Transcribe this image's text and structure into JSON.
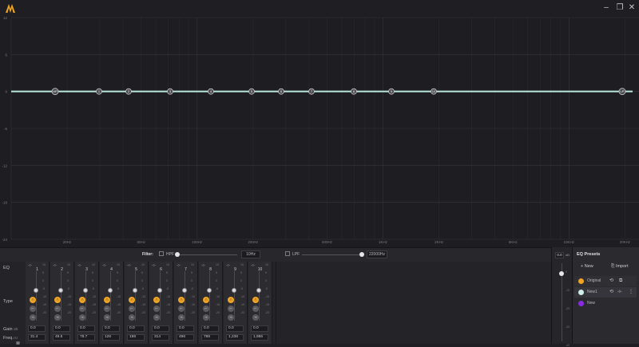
{
  "window": {
    "logo": "app-logo-icon",
    "buttons": [
      "minimize-icon",
      "maximize-icon",
      "close-icon"
    ]
  },
  "graph": {
    "y_ticks": [
      "12",
      "6",
      "0",
      "-6",
      "-12",
      "-18",
      "-24"
    ],
    "x_ticks": [
      "20Hz",
      "50Hz",
      "100Hz",
      "200Hz",
      "500Hz",
      "1KHz",
      "2KHz",
      "5KHz",
      "10KHz",
      "20KHz"
    ],
    "curve_color": "#b9e8df",
    "node_labels": [
      "HP",
      "1",
      "2",
      "3",
      "4",
      "5",
      "6",
      "7",
      "8",
      "9",
      "10",
      "LP"
    ]
  },
  "filter": {
    "label": "Filter:",
    "hpf_label": "HPF",
    "hpf_value": "10Hz",
    "lpf_label": "LPF",
    "lpf_value": "22000Hz"
  },
  "rows": {
    "eq": "EQ",
    "type": "Type",
    "gain": "Gain",
    "gain_unit": "dB",
    "freq": "Freq.",
    "freq_unit": "Hz",
    "q_label": "Q"
  },
  "band_scale": [
    "10",
    "5",
    "0",
    "-5",
    "-10",
    "-15",
    "-20"
  ],
  "bands": [
    {
      "num": "1",
      "gain": "0.0",
      "freq": "31.4"
    },
    {
      "num": "2",
      "gain": "0.0",
      "freq": "49.5"
    },
    {
      "num": "3",
      "gain": "0.0",
      "freq": "78.7"
    },
    {
      "num": "4",
      "gain": "0.0",
      "freq": "126"
    },
    {
      "num": "5",
      "gain": "0.0",
      "freq": "198"
    },
    {
      "num": "6",
      "gain": "0.0",
      "freq": "314"
    },
    {
      "num": "7",
      "gain": "0.0",
      "freq": "496"
    },
    {
      "num": "8",
      "gain": "0.0",
      "freq": "786"
    },
    {
      "num": "9",
      "gain": "0.0",
      "freq": "1,236"
    },
    {
      "num": "10",
      "gain": "0.0",
      "freq": "1,986"
    }
  ],
  "master": {
    "value": "0.0",
    "unit": "dB",
    "scale": [
      "0",
      "-10",
      "-20",
      "-30",
      "-40"
    ]
  },
  "presets": {
    "title": "EQ Presets",
    "new_btn": "New",
    "import_btn": "Import",
    "items": [
      {
        "name": "Original",
        "color": "#f0a425"
      },
      {
        "name": "New1",
        "color": "#cfeee6"
      },
      {
        "name": "New",
        "color": "#8a2be2"
      }
    ]
  },
  "colors": {
    "accent": "#f0a425",
    "curve": "#b9e8df"
  }
}
